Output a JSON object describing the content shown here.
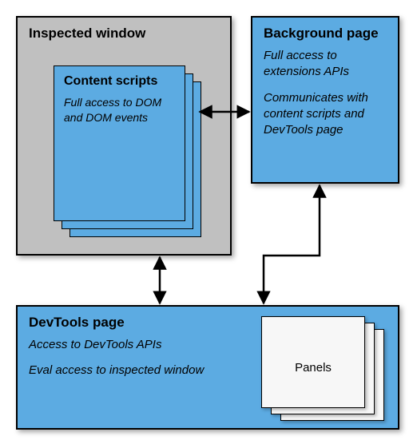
{
  "inspected": {
    "title": "Inspected window",
    "content_scripts": {
      "title": "Content scripts",
      "desc": "Full access to DOM and DOM events"
    }
  },
  "background": {
    "title": "Background page",
    "desc1": "Full access to extensions APIs",
    "desc2": "Communicates with content scripts and DevTools page"
  },
  "devtools": {
    "title": "DevTools page",
    "desc1": "Access to DevTools APIs",
    "desc2": "Eval access to inspected window",
    "panels_label": "Panels"
  }
}
